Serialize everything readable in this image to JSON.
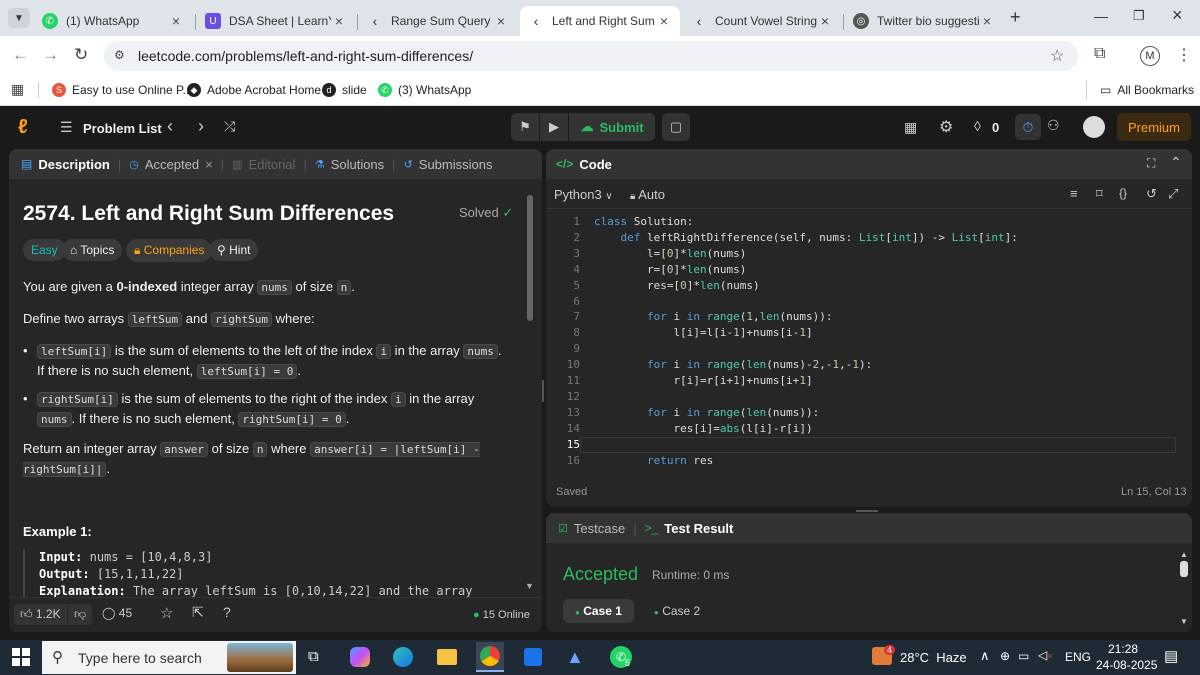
{
  "browser": {
    "tabs": [
      {
        "title": "(1) WhatsApp",
        "icon": "whatsapp-icon"
      },
      {
        "title": "DSA Sheet | LearnYard",
        "icon": "learnyard-icon"
      },
      {
        "title": "Range Sum Query - Im",
        "icon": "leetcode-icon"
      },
      {
        "title": "Left and Right Sum D",
        "icon": "leetcode-icon"
      },
      {
        "title": "Count Vowel Strings",
        "icon": "leetcode-icon"
      },
      {
        "title": "Twitter bio suggestion",
        "icon": "chatgpt-icon"
      }
    ],
    "url": "leetcode.com/problems/left-and-right-sum-differences/",
    "profile_initial": "M",
    "bookmarks": [
      {
        "label": "Easy to use Online P..."
      },
      {
        "label": "Adobe Acrobat Home"
      },
      {
        "label": "slide"
      },
      {
        "label": "(3) WhatsApp"
      }
    ],
    "all_bookmarks": "All Bookmarks"
  },
  "nav": {
    "problem_list": "Problem List",
    "submit": "Submit",
    "streak": "0",
    "premium": "Premium"
  },
  "left": {
    "tabs": {
      "description": "Description",
      "accepted": "Accepted",
      "editorial": "Editorial",
      "solutions": "Solutions",
      "submissions": "Submissions"
    },
    "title": "2574. Left and Right Sum Differences",
    "solved": "Solved",
    "tags": {
      "easy": "Easy",
      "topics": "Topics",
      "companies": "Companies",
      "hint": "Hint"
    },
    "p1": {
      "a": "You are given a ",
      "b": "0-indexed",
      "c": " integer array ",
      "d": "nums",
      "e": " of size ",
      "f": "n",
      "g": "."
    },
    "p2": {
      "a": "Define two arrays ",
      "b": "leftSum",
      "c": " and ",
      "d": "rightSum",
      "e": " where:"
    },
    "b1": {
      "a": "leftSum[i]",
      "b": " is the sum of elements to the left of the index ",
      "c": "i",
      "d": " in the array ",
      "e": "nums",
      "f": ". If there is no such element, ",
      "g": "leftSum[i] = 0",
      "h": "."
    },
    "b2": {
      "a": "rightSum[i]",
      "b": " is the sum of elements to the right of the index ",
      "c": "i",
      "d": " in the array ",
      "e": "nums",
      "f": ". If there is no such element, ",
      "g": "rightSum[i] = 0",
      "h": "."
    },
    "p3": {
      "a": "Return an integer array ",
      "b": "answer",
      "c": " of size ",
      "d": "n",
      "e": " where ",
      "f": "answer[i] = |leftSum[i] - rightSum[i]|",
      "g": "."
    },
    "example_title": "Example 1:",
    "input_label": "Input:",
    "input_value": "nums = [10,4,8,3]",
    "output_label": "Output:",
    "output_value": "[15,1,11,22]",
    "explanation_label": "Explanation:",
    "explanation_value": "The array leftSum is [0,10,14,22] and the array",
    "likes": "1.2K",
    "comments": "45",
    "online": "15 Online"
  },
  "code": {
    "title": "Code",
    "language": "Python3",
    "mode": "Auto",
    "saved": "Saved",
    "cursor": "Ln 15, Col 13",
    "lines": [
      "class Solution:",
      "    def leftRightDifference(self, nums: List[int]) -> List[int]:",
      "        l=[0]*len(nums)",
      "        r=[0]*len(nums)",
      "        res=[0]*len(nums)",
      "",
      "        for i in range(1,len(nums)):",
      "            l[i]=l[i-1]+nums[i-1]",
      "",
      "        for i in range(len(nums)-2,-1,-1):",
      "            r[i]=r[i+1]+nums[i+1]",
      "",
      "        for i in range(len(nums)):",
      "            res[i]=abs(l[i]-r[i])",
      "",
      "        return res"
    ]
  },
  "test": {
    "testcase": "Testcase",
    "result": "Test Result",
    "status": "Accepted",
    "runtime": "Runtime: 0 ms",
    "case1": "Case 1",
    "case2": "Case 2"
  },
  "taskbar": {
    "search": "Type here to search",
    "weather": "28°C  Haze",
    "lang": "ENG",
    "time": "21:28",
    "date": "24-08-2025",
    "whatsapp_badge": "5",
    "notif_badge": "4"
  },
  "colors": {
    "accent": "#ffa116",
    "green": "#2cbb5d",
    "blue": "#1a73e8"
  }
}
